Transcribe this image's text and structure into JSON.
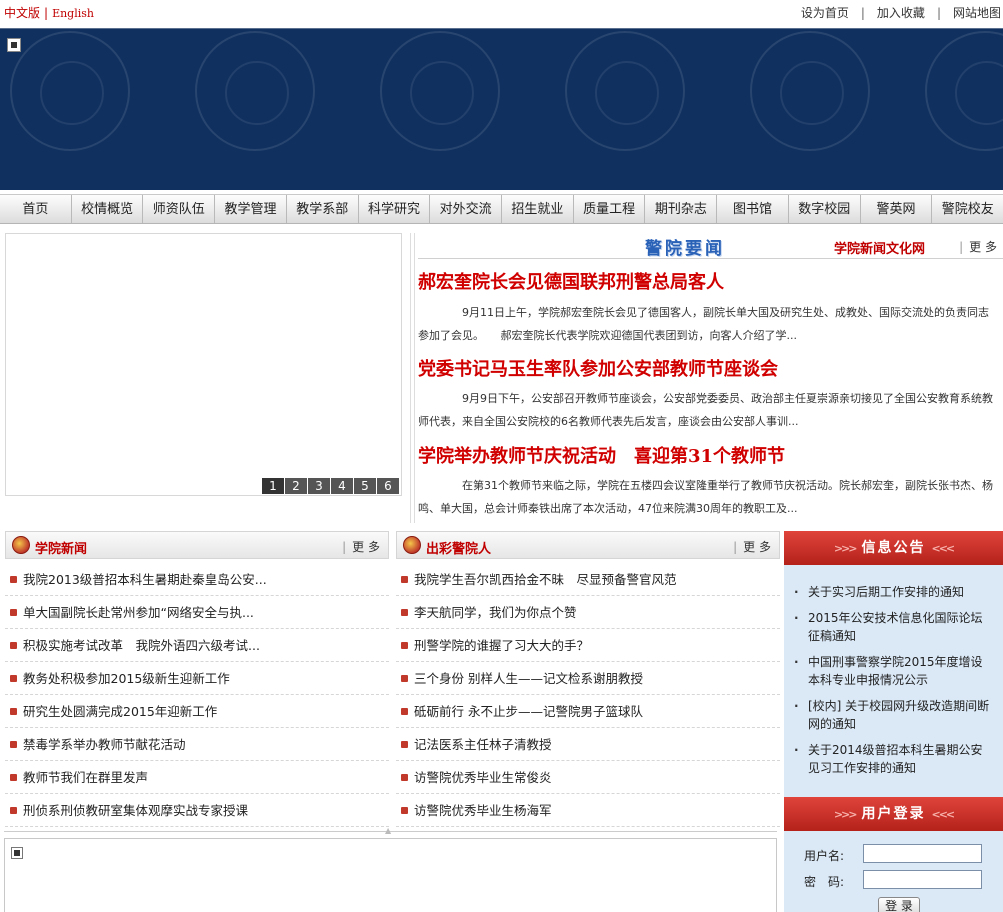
{
  "top": {
    "lang_zh": "中文版",
    "lang_sep": "|",
    "lang_en": "English",
    "links": [
      "设为首页",
      "加入收藏",
      "网站地图"
    ]
  },
  "nav": [
    "首页",
    "校情概览",
    "师资队伍",
    "教学管理",
    "教学系部",
    "科学研究",
    "对外交流",
    "招生就业",
    "质量工程",
    "期刊杂志",
    "图书馆",
    "数字校园",
    "警英网",
    "警院校友"
  ],
  "slideshow": {
    "pages": [
      "1",
      "2",
      "3",
      "4",
      "5",
      "6"
    ]
  },
  "news": {
    "title": "警院要闻",
    "link": "学院新闻文化网",
    "more": "更 多",
    "items": [
      {
        "headline": "郝宏奎院长会见德国联邦刑警总局客人",
        "summary": "9月11日上午，学院郝宏奎院长会见了德国客人，副院长单大国及研究生处、成教处、国际交流处的负责同志参加了会见。　　郝宏奎院长代表学院欢迎德国代表团到访，向客人介绍了学..."
      },
      {
        "headline": "党委书记马玉生率队参加公安部教师节座谈会",
        "summary": "9月9日下午，公安部召开教师节座谈会，公安部党委委员、政治部主任夏崇源亲切接见了全国公安教育系统教师代表，来自全国公安院校的6名教师代表先后发言，座谈会由公安部人事训..."
      },
      {
        "headline": "学院举办教师节庆祝活动　喜迎第31个教师节",
        "summary": "在第31个教师节来临之际，学院在五楼四会议室隆重举行了教师节庆祝活动。院长郝宏奎，副院长张书杰、杨鸣、单大国，总会计师秦铁出席了本次活动，47位来院满30周年的教职工及..."
      }
    ]
  },
  "college_news": {
    "title": "学院新闻",
    "more": "更 多",
    "items": [
      "我院2013级普招本科生暑期赴秦皇岛公安...",
      "单大国副院长赴常州参加“网络安全与执...",
      "积极实施考试改革　我院外语四六级考试...",
      "教务处积极参加2015级新生迎新工作",
      "研究生处圆满完成2015年迎新工作",
      "禁毒学系举办教师节献花活动",
      "教师节我们在群里发声",
      "刑侦系刑侦教研室集体观摩实战专家授课"
    ]
  },
  "outstanding": {
    "title": "出彩警院人",
    "more": "更 多",
    "items": [
      "我院学生吾尔凯西拾金不昧　尽显预备警官风范",
      "李天航同学，我们为你点个赞",
      "刑警学院的谁握了习大大的手？",
      "三个身份 别样人生——记文检系谢朋教授",
      "砥砺前行 永不止步——记警院男子篮球队",
      "记法医系主任林子清教授",
      "访警院优秀毕业生常俊炎",
      "访警院优秀毕业生杨海军"
    ]
  },
  "notices": {
    "title": "信息公告",
    "items": [
      "关于实习后期工作安排的通知",
      "2015年公安技术信息化国际论坛征稿通知",
      "中国刑事警察学院2015年度增设本科专业申报情况公示",
      "[校内] 关于校园网升级改造期间断网的通知",
      "关于2014级普招本科生暑期公安见习工作安排的通知"
    ]
  },
  "login": {
    "title": "用户登录",
    "username_label": "用户名:",
    "password_label": "密　码:",
    "button": "登 录"
  },
  "colors": {
    "accent_red": "#c00000",
    "banner_blue": "#10305f",
    "news_blue": "#2a62b8",
    "sidebar_bg": "#dbe9f7"
  }
}
